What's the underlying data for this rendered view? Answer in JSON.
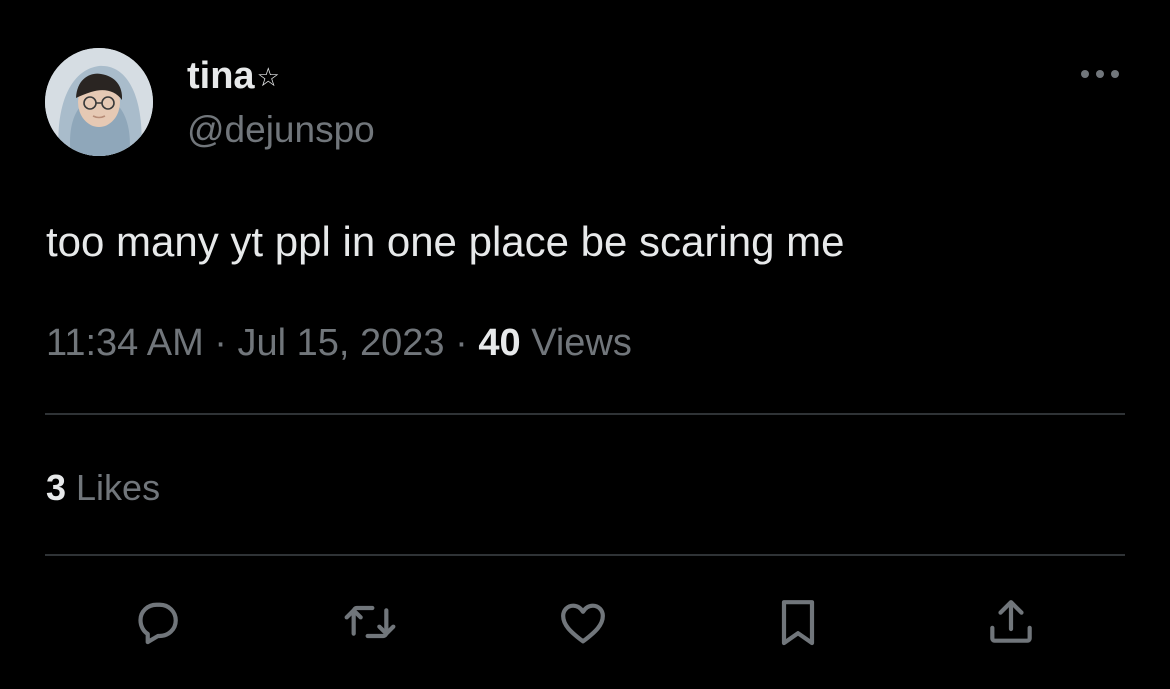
{
  "author": {
    "display_name": "tina",
    "name_symbol": "☆",
    "handle": "@dejunspo"
  },
  "tweet": {
    "text": "too many yt ppl in one place be scaring me",
    "time": "11:34 AM",
    "date": "Jul 15, 2023",
    "separator": "·",
    "views_count": "40",
    "views_label": " Views"
  },
  "stats": {
    "likes_count": "3",
    "likes_label": " Likes"
  },
  "actions": [
    {
      "icon": "reply-icon"
    },
    {
      "icon": "retweet-icon"
    },
    {
      "icon": "like-icon"
    },
    {
      "icon": "bookmark-icon"
    },
    {
      "icon": "share-icon"
    }
  ],
  "colors": {
    "background": "#000000",
    "primary_text": "#e7e9ea",
    "secondary_text": "#71767b",
    "divider": "#2f3336"
  }
}
